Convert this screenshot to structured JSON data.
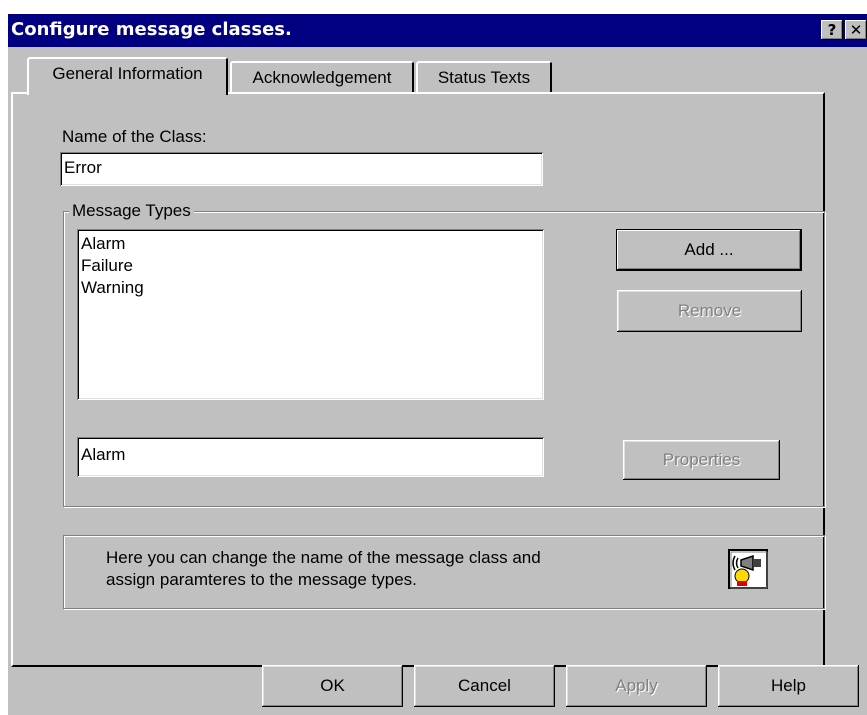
{
  "window": {
    "title": "Configure message classes.",
    "help_button": "?",
    "close_button": "✕"
  },
  "tabs": [
    {
      "label": "General Information",
      "active": true
    },
    {
      "label": "Acknowledgement",
      "active": false
    },
    {
      "label": "Status Texts",
      "active": false
    }
  ],
  "general": {
    "class_name_label": "Name of the Class:",
    "class_name_value": "Error",
    "message_types_group": "Message Types",
    "message_types": [
      "Alarm",
      "Failure",
      "Warning"
    ],
    "selected_type_value": "Alarm",
    "add_label": "Add ...",
    "remove_label": "Remove",
    "properties_label": "Properties",
    "info_text_line1": "Here you can change the name of the message class and",
    "info_text_line2": "assign paramteres to the message types."
  },
  "footer": {
    "ok_label": "OK",
    "cancel_label": "Cancel",
    "apply_label": "Apply",
    "help_label": "Help"
  },
  "colors": {
    "titlebar": "#000080",
    "face": "#c0c0c0"
  }
}
